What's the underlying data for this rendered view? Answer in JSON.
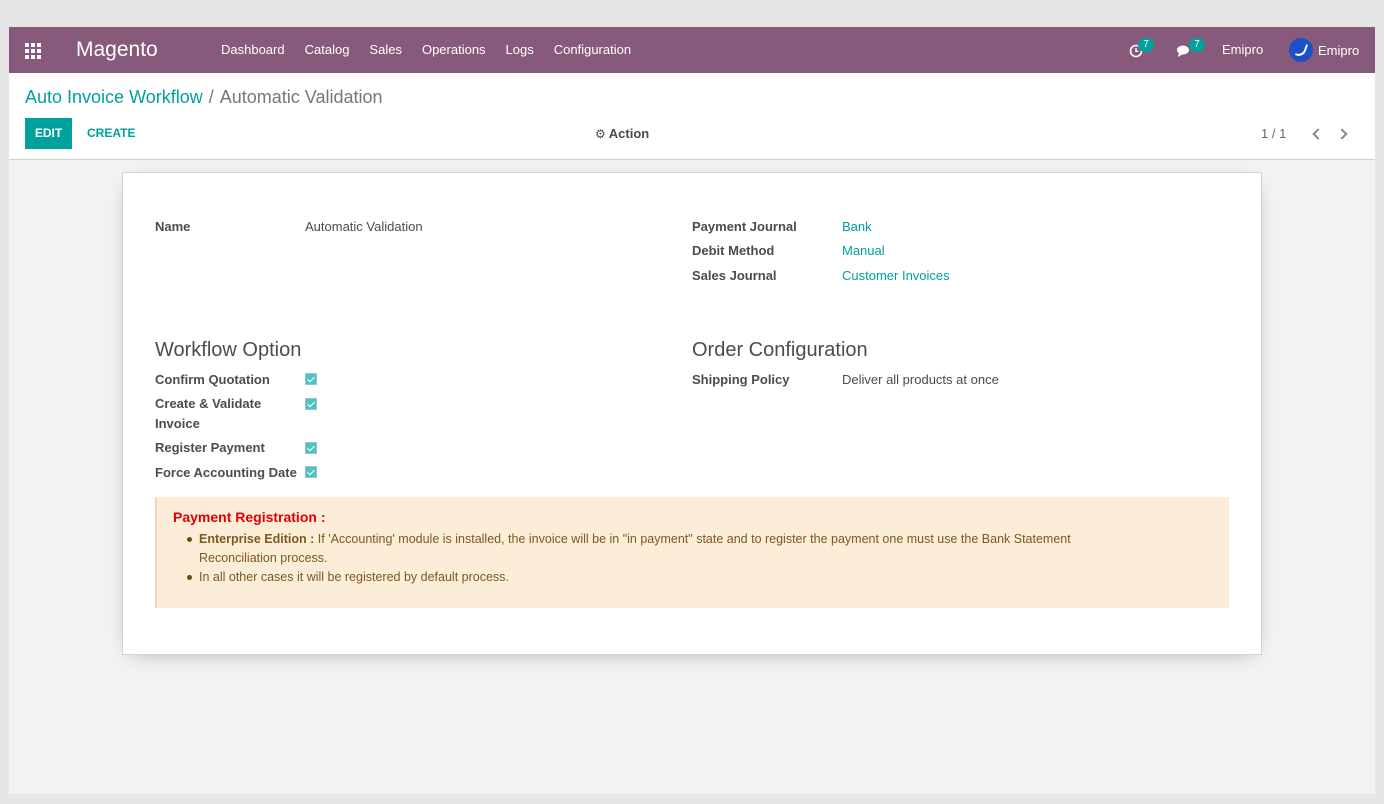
{
  "navbar": {
    "brand": "Magento",
    "menu": [
      "Dashboard",
      "Catalog",
      "Sales",
      "Operations",
      "Logs",
      "Configuration"
    ],
    "activity_count": "7",
    "message_count": "7",
    "company": "Emipro",
    "user": "Emipro"
  },
  "breadcrumb": {
    "parent": "Auto Invoice Workflow",
    "separator": "/",
    "current": "Automatic Validation"
  },
  "buttons": {
    "edit": "EDIT",
    "create": "CREATE",
    "action": "Action"
  },
  "pager": {
    "value": "1 / 1"
  },
  "form": {
    "name_label": "Name",
    "name_value": "Automatic Validation",
    "payment_journal_label": "Payment Journal",
    "payment_journal_value": "Bank",
    "debit_method_label": "Debit Method",
    "debit_method_value": "Manual",
    "sales_journal_label": "Sales Journal",
    "sales_journal_value": "Customer Invoices",
    "workflow_title": "Workflow Option",
    "confirm_quotation_label": "Confirm Quotation",
    "create_validate_label_1": "Create & Validate",
    "create_validate_label_2": "Invoice",
    "register_payment_label": "Register Payment",
    "force_accounting_label": "Force Accounting Date",
    "order_config_title": "Order Configuration",
    "shipping_policy_label": "Shipping Policy",
    "shipping_policy_value": "Deliver all products at once",
    "checkboxes": {
      "confirm_quotation": true,
      "create_validate_invoice": true,
      "register_payment": true,
      "force_accounting_date": true
    }
  },
  "alert": {
    "title": "Payment Registration :",
    "item1_bold": "Enterprise Edition :",
    "item1_text": " If 'Accounting' module is installed, the invoice will be in \"in payment\" state and to register the payment one must use the Bank Statement Reconciliation process.",
    "item2_text": "In all other cases it will be registered by default process."
  }
}
